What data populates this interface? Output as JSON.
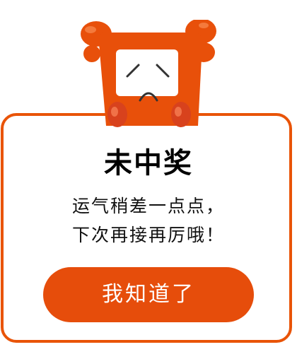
{
  "dialog": {
    "title": "未中奖",
    "message_line1": "运气稍差一点点，",
    "message_line2": "下次再接再厉哦！",
    "confirm_label": "我知道了"
  },
  "colors": {
    "accent": "#e95408",
    "button": "#e64d0b",
    "mascot_body": "#e8500a",
    "mascot_hand": "#d8421d"
  },
  "icons": {
    "mascot": "sad-mascot-icon"
  }
}
